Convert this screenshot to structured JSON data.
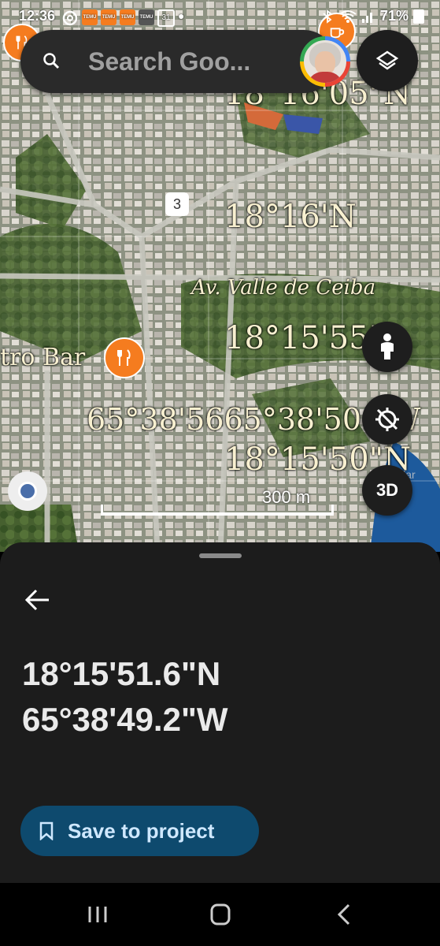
{
  "status_bar": {
    "time": "12:36",
    "app_badges": [
      "TEMU",
      "TEMU",
      "TEMU",
      "TEMU"
    ],
    "calendar_day": "31",
    "battery": "71%"
  },
  "search": {
    "placeholder": "Search Goo..."
  },
  "map": {
    "labels": {
      "lat_1": "18°16'05\"N",
      "lat_2": "18°16'N",
      "street": "Av. Valle de Ceiba",
      "lat_3": "18°15'55\"",
      "poi": "tro Bar",
      "lon_overlap": "65°38'5665°38'50.5W",
      "lat_4": "18°15'50\"N"
    },
    "route_number": "3",
    "scale_label": "300 m",
    "watermark": "Stellar MLS",
    "button_3d": "3D"
  },
  "sheet": {
    "latitude": "18°15'51.6\"N",
    "longitude": "65°38'49.2\"W",
    "save_label": "Save to project"
  },
  "colors": {
    "sheet_bg": "#1c1c1c",
    "save_bg": "#0e4a6e",
    "poi_orange": "#f57c1f"
  }
}
